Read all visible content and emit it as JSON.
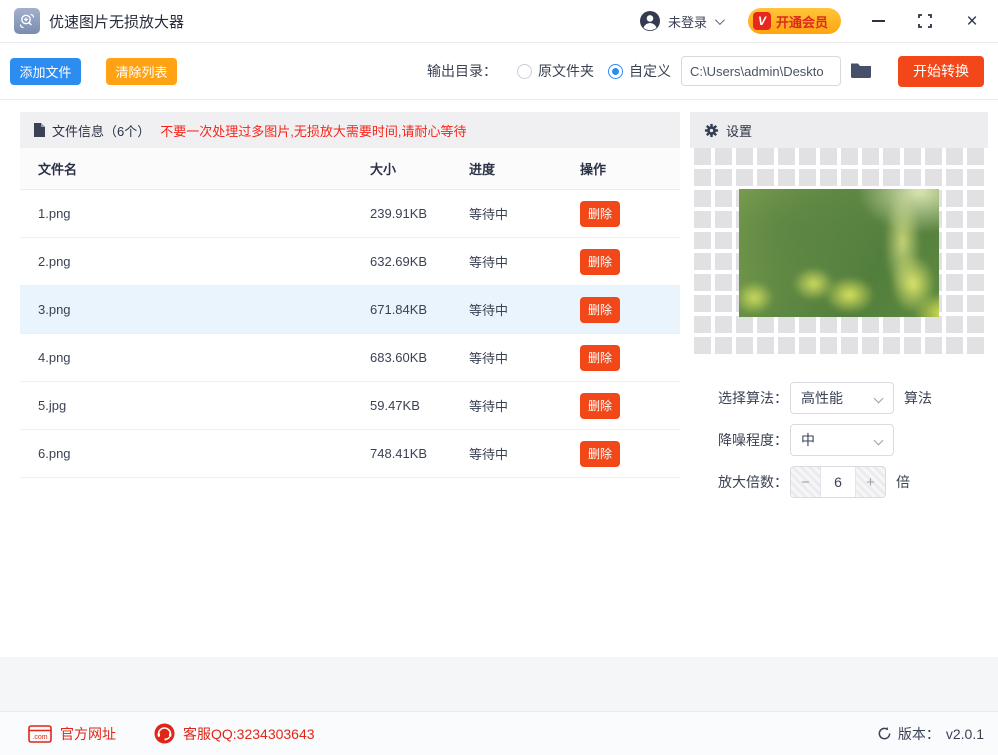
{
  "titlebar": {
    "app_title": "优速图片无损放大器",
    "login_label": "未登录",
    "vip_badge": "V",
    "vip_label": "开通会员",
    "close_glyph": "×"
  },
  "toolbar": {
    "add_files": "添加文件",
    "clear_list": "清除列表",
    "output_dir_label": "输出目录：",
    "radio_original": "原文件夹",
    "radio_custom": "自定义",
    "path_value": "C:\\Users\\admin\\Deskto",
    "start_convert": "开始转换"
  },
  "file_panel": {
    "title": "文件信息（6个）",
    "warning": "不要一次处理过多图片,无损放大需要时间,请耐心等待",
    "columns": [
      "文件名",
      "大小",
      "进度",
      "操作"
    ],
    "delete_label": "删除",
    "rows": [
      {
        "name": "1.png",
        "size": "239.91KB",
        "status": "等待中",
        "highlighted": false
      },
      {
        "name": "2.png",
        "size": "632.69KB",
        "status": "等待中",
        "highlighted": false
      },
      {
        "name": "3.png",
        "size": "671.84KB",
        "status": "等待中",
        "highlighted": true
      },
      {
        "name": "4.png",
        "size": "683.60KB",
        "status": "等待中",
        "highlighted": false
      },
      {
        "name": "5.jpg",
        "size": "59.47KB",
        "status": "等待中",
        "highlighted": false
      },
      {
        "name": "6.png",
        "size": "748.41KB",
        "status": "等待中",
        "highlighted": false
      }
    ]
  },
  "settings_panel": {
    "title": "设置",
    "algorithm_label": "选择算法：",
    "algorithm_value": "高性能",
    "algorithm_suffix": "算法",
    "denoise_label": "降噪程度：",
    "denoise_value": "中",
    "scale_label": "放大倍数：",
    "scale_minus": "−",
    "scale_value": "6",
    "scale_plus": "+",
    "scale_suffix": "倍"
  },
  "footer": {
    "com_icon_text": ".com",
    "website_label": "官方网址",
    "qq_label": "客服QQ:3234303643",
    "version_label": "版本：",
    "version_value": "v2.0.1"
  },
  "colors": {
    "accent_blue": "#2D8CF0",
    "accent_orange": "#FFA214",
    "accent_red": "#F24718",
    "warning_red": "#F5251A",
    "footer_red": "#E02617",
    "vip_gradient_top": "#FFC53A",
    "vip_gradient_bottom": "#FFA50F",
    "row_highlight": "#EAF4FD",
    "panel_header_bg": "#F0F0F2",
    "checker_gray": "#E1E1E4"
  }
}
